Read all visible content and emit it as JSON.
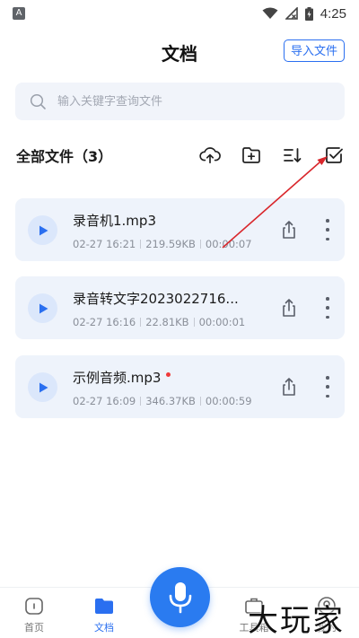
{
  "status_bar": {
    "app_icon_letter": "A",
    "time": "4:25",
    "icons": [
      "wifi-icon",
      "signal-off-icon",
      "battery-charging-icon"
    ]
  },
  "header": {
    "title": "文档",
    "import_button": "导入文件"
  },
  "search": {
    "placeholder": "输入关键字查询文件"
  },
  "section": {
    "title": "全部文件（3）",
    "toolbar_icons": [
      "cloud-upload-icon",
      "new-folder-icon",
      "sort-icon",
      "multi-select-icon"
    ]
  },
  "files": [
    {
      "name": "录音机1.mp3",
      "date": "02-27 16:21",
      "size": "219.59KB",
      "duration": "00:00:07",
      "new": false
    },
    {
      "name": "录音转文字2023022716...",
      "date": "02-27 16:16",
      "size": "22.81KB",
      "duration": "00:00:01",
      "new": false
    },
    {
      "name": "示例音频.mp3",
      "date": "02-27 16:09",
      "size": "346.37KB",
      "duration": "00:00:59",
      "new": true
    }
  ],
  "bottom_nav": {
    "items": [
      {
        "label": "首页",
        "icon": "home-icon",
        "active": false
      },
      {
        "label": "文档",
        "icon": "folder-icon",
        "active": true
      },
      {
        "label": "工具箱",
        "icon": "toolbox-icon",
        "active": false
      },
      {
        "label": "我的",
        "icon": "profile-icon",
        "active": false
      }
    ],
    "center_button_icon": "microphone-icon"
  },
  "watermark": "大玩家",
  "colors": {
    "accent": "#2a6ff0",
    "card_bg": "#eef3fb",
    "annotation": "#d9262b",
    "new_dot": "#ef3a3a"
  }
}
